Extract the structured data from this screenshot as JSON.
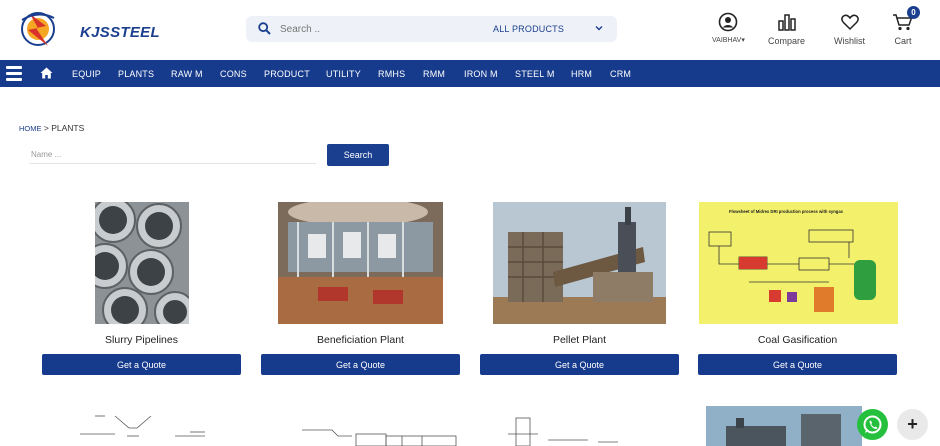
{
  "header": {
    "logo_text": "KJSSTEEL",
    "search": {
      "placeholder": "Search ..",
      "category": "ALL PRODUCTS"
    },
    "account_label": "VAIBHAV",
    "compare_label": "Compare",
    "wishlist_label": "Wishlist",
    "cart_label": "Cart",
    "cart_count": "0"
  },
  "nav": {
    "items": [
      "EQUIP",
      "PLANTS",
      "RAW M",
      "CONS",
      "PRODUCT",
      "UTILITY",
      "RMHS",
      "RMM",
      "IRON M",
      "STEEL M",
      "HRM",
      "CRM"
    ]
  },
  "breadcrumb": {
    "home": "HOME",
    "separator": ">",
    "current": "PLANTS"
  },
  "filter": {
    "name_placeholder": "Name ...",
    "search_label": "Search"
  },
  "products": [
    {
      "title": "Slurry Pipelines",
      "quote_label": "Get a Quote"
    },
    {
      "title": "Beneficiation Plant",
      "quote_label": "Get a Quote"
    },
    {
      "title": "Pellet Plant",
      "quote_label": "Get a Quote"
    },
    {
      "title": "Coal Gasification",
      "quote_label": "Get a Quote"
    }
  ],
  "flowsheet_caption": "Flowsheet of Midrex DRI production process with syngas",
  "floating": {
    "plus": "+"
  },
  "colors": {
    "brand": "#173b8c",
    "whatsapp": "#25c03d",
    "accent": "#f5a623"
  },
  "icons": [
    "search-icon",
    "chevron-down-icon",
    "user-icon",
    "compare-icon",
    "heart-icon",
    "cart-icon",
    "menu-icon",
    "home-icon",
    "whatsapp-icon",
    "plus-icon"
  ]
}
